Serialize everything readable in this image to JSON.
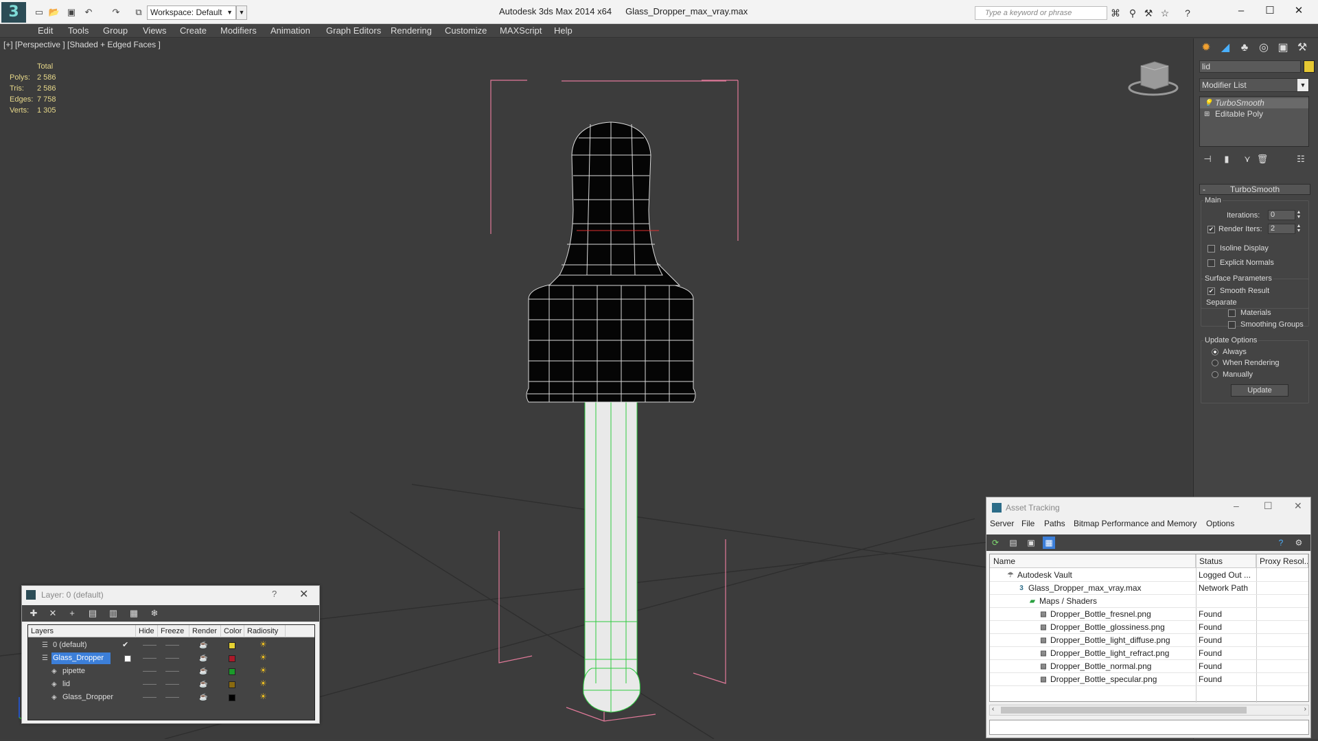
{
  "titlebar": {
    "app": "Autodesk 3ds Max  2014 x64",
    "file": "Glass_Dropper_max_vray.max",
    "workspace": "Workspace: Default",
    "search_placeholder": "Type a keyword or phrase",
    "logo": "3"
  },
  "menu": [
    "Edit",
    "Tools",
    "Group",
    "Views",
    "Create",
    "Modifiers",
    "Animation",
    "Graph Editors",
    "Rendering",
    "Customize",
    "MAXScript",
    "Help"
  ],
  "viewport": {
    "label": "[+] [Perspective ] [Shaded + Edged Faces ]",
    "stats_header": "Total",
    "stats": [
      {
        "k": "Polys:",
        "v": "2 586"
      },
      {
        "k": "Tris:",
        "v": "2 586"
      },
      {
        "k": "Edges:",
        "v": "7 758"
      },
      {
        "k": "Verts:",
        "v": "1 305"
      }
    ]
  },
  "command_panel": {
    "object_name": "lid",
    "object_color": "#e6c833",
    "modifier_list": "Modifier List",
    "stack": [
      "TurboSmooth",
      "Editable Poly"
    ],
    "rollout_title": "TurboSmooth",
    "main_label": "Main",
    "iterations_label": "Iterations:",
    "iterations_value": "0",
    "render_iters_label": "Render Iters:",
    "render_iters_value": "2",
    "isoline_label": "Isoline Display",
    "explicit_normals_label": "Explicit Normals",
    "surface_params_label": "Surface Parameters",
    "smooth_result_label": "Smooth Result",
    "separate_label": "Separate",
    "materials_label": "Materials",
    "smoothing_groups_label": "Smoothing Groups",
    "update_options_label": "Update Options",
    "always_label": "Always",
    "when_rendering_label": "When Rendering",
    "manually_label": "Manually",
    "update_button": "Update"
  },
  "layer_window": {
    "title": "Layer: 0 (default)",
    "help": "?",
    "columns": [
      "Layers",
      "Hide",
      "Freeze",
      "Render",
      "Color",
      "Radiosity"
    ],
    "rows": [
      {
        "name": "0 (default)",
        "color": "#e6d233",
        "indent": 0,
        "selected": false,
        "current": true
      },
      {
        "name": "Glass_Dropper",
        "color": "#aa1a2a",
        "indent": 0,
        "selected": true,
        "current": false
      },
      {
        "name": "pipette",
        "color": "#1a9a2a",
        "indent": 1,
        "selected": false,
        "current": false
      },
      {
        "name": "lid",
        "color": "#8a6a10",
        "indent": 1,
        "selected": false,
        "current": false
      },
      {
        "name": "Glass_Dropper",
        "color": "#000000",
        "indent": 1,
        "selected": false,
        "current": false
      }
    ]
  },
  "asset_window": {
    "title": "Asset Tracking",
    "menu": [
      "Server",
      "File",
      "Paths",
      "Bitmap Performance and Memory",
      "Options"
    ],
    "columns": [
      "Name",
      "Status",
      "Proxy Resol..."
    ],
    "rows": [
      {
        "name": "Autodesk Vault",
        "status": "Logged Out ...",
        "indent": 1
      },
      {
        "name": "Glass_Dropper_max_vray.max",
        "status": "Network Path",
        "indent": 2
      },
      {
        "name": "Maps / Shaders",
        "status": "",
        "indent": 3
      },
      {
        "name": "Dropper_Bottle_fresnel.png",
        "status": "Found",
        "indent": 4
      },
      {
        "name": "Dropper_Bottle_glossiness.png",
        "status": "Found",
        "indent": 4
      },
      {
        "name": "Dropper_Bottle_light_diffuse.png",
        "status": "Found",
        "indent": 4
      },
      {
        "name": "Dropper_Bottle_light_refract.png",
        "status": "Found",
        "indent": 4
      },
      {
        "name": "Dropper_Bottle_normal.png",
        "status": "Found",
        "indent": 4
      },
      {
        "name": "Dropper_Bottle_specular.png",
        "status": "Found",
        "indent": 4
      }
    ]
  }
}
